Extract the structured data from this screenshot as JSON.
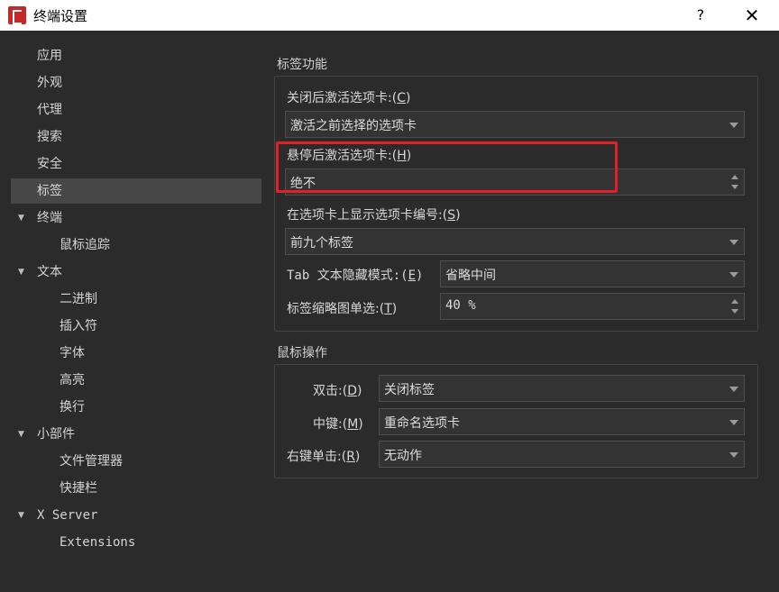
{
  "window": {
    "title": "终端设置",
    "help": "?",
    "close": "✕"
  },
  "sidebar": [
    {
      "label": "应用",
      "level": 0,
      "top": 0
    },
    {
      "label": "外观",
      "level": 0
    },
    {
      "label": "代理",
      "level": 0
    },
    {
      "label": "搜索",
      "level": 0
    },
    {
      "label": "安全",
      "level": 0
    },
    {
      "label": "标签",
      "level": 0,
      "selected": true
    },
    {
      "label": "终端",
      "level": 0,
      "expanded": true
    },
    {
      "label": "鼠标追踪",
      "level": 1
    },
    {
      "label": "文本",
      "level": 0,
      "expanded": true
    },
    {
      "label": "二进制",
      "level": 1
    },
    {
      "label": "插入符",
      "level": 1
    },
    {
      "label": "字体",
      "level": 1
    },
    {
      "label": "高亮",
      "level": 1
    },
    {
      "label": "换行",
      "level": 1
    },
    {
      "label": "小部件",
      "level": 0,
      "expanded": true
    },
    {
      "label": "文件管理器",
      "level": 1
    },
    {
      "label": "快捷栏",
      "level": 1
    },
    {
      "label": "X Server",
      "level": 0,
      "expanded": true
    },
    {
      "label": "Extensions",
      "level": 1
    }
  ],
  "tabs_group": {
    "title": "标签功能",
    "close_label_pre": "关闭后激活选项卡:(",
    "close_key": "C",
    "close_value": "激活之前选择的选项卡",
    "hover_label_pre": "悬停后激活选项卡:(",
    "hover_key": "H",
    "hover_value": "绝不",
    "number_label_pre": "在选项卡上显示选项卡编号:(",
    "number_key": "S",
    "number_value": "前九个标签",
    "hide_label_pre": "Tab 文本隐藏模式:(",
    "hide_key": "E",
    "hide_value": "省略中间",
    "thumb_label_pre": "标签缩略图单选:(",
    "thumb_key": "T",
    "thumb_value": "40 %",
    "paren_close": ")"
  },
  "mouse_group": {
    "title": "鼠标操作",
    "dbl_label_pre": "双击:(",
    "dbl_key": "D",
    "dbl_value": "关闭标签",
    "mid_label_pre": "中键:(",
    "mid_key": "M",
    "mid_value": "重命名选项卡",
    "right_label_pre": "右键单击:(",
    "right_key": "R",
    "right_value": "无动作",
    "paren_close": ")"
  },
  "colors": {
    "highlight": "#e0202b",
    "selected": "#474747"
  }
}
